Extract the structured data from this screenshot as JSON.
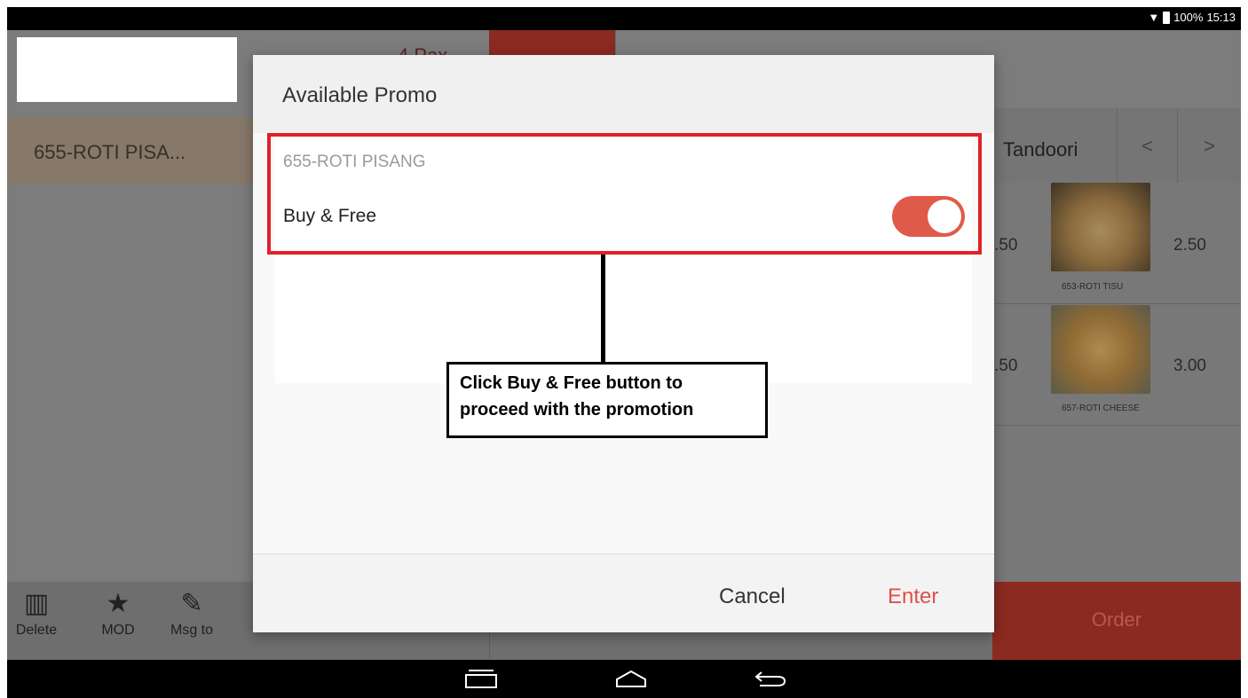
{
  "status_bar": {
    "battery": "100%",
    "time": "15:13",
    "wifi_icon": "wifi-icon",
    "battery_icon": "battery-icon"
  },
  "background_app": {
    "pax_label": "4  Pax",
    "order_item": "655-ROTI PISA...",
    "category": {
      "label": "Tandoori",
      "prev": "<",
      "next": ">"
    },
    "menu_items": [
      {
        "partial_price": ".50",
        "price": "2.50",
        "name": "653-ROTI TISU"
      },
      {
        "partial_price": ".50",
        "price": "3.00",
        "name": "657-ROTI CHEESE"
      }
    ],
    "tools": [
      {
        "label": "Delete",
        "icon": "trash-icon"
      },
      {
        "label": "MOD",
        "icon": "star-icon"
      },
      {
        "label": "Msg to",
        "icon": "pencil-icon"
      }
    ],
    "order_button": "Order"
  },
  "dialog": {
    "title": "Available Promo",
    "promo": {
      "name": "655-ROTI PISANG",
      "type": "Buy & Free",
      "enabled": true
    },
    "cancel": "Cancel",
    "enter": "Enter"
  },
  "annotation": {
    "text_line1": "Click Buy & Free button to",
    "text_line2": "proceed with the promotion"
  },
  "colors": {
    "accent": "#e0504a",
    "highlight": "#e0202a"
  }
}
